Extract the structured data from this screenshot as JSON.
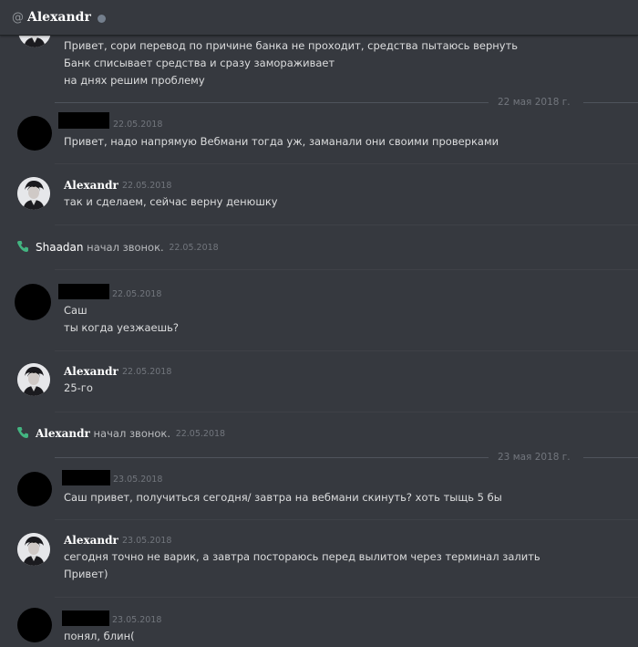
{
  "header": {
    "at_symbol": "@",
    "title": "Alexandr",
    "status": "offline"
  },
  "dividers": [
    "22 мая 2018 г.",
    "23 мая 2018 г."
  ],
  "messages": [
    {
      "lines": [
        "Привет, сори перевод по причине банка не проходит, средства пытаюсь вернуть",
        "Банк списывает средства и сразу замораживает",
        "на днях решим проблему"
      ]
    },
    {
      "time": "22.05.2018",
      "lines": [
        "Привет, надо напрямую Вебмани тогда уж, заманали они своими проверками"
      ]
    },
    {
      "author": "Alexandr",
      "time": "22.05.2018",
      "lines": [
        "так и сделаем, сейчас верну денюшку"
      ]
    },
    {
      "author": "Shaadan",
      "text": "начал звонок.",
      "time": "22.05.2018"
    },
    {
      "time": "22.05.2018",
      "lines": [
        "Саш",
        "ты когда уезжаешь?"
      ]
    },
    {
      "author": "Alexandr",
      "time": "22.05.2018",
      "lines": [
        "25-го"
      ]
    },
    {
      "author": "Alexandr",
      "text": "начал звонок.",
      "time": "22.05.2018"
    },
    {
      "time": "23.05.2018",
      "lines": [
        "Саш привет,  получиться сегодня/ завтра  на вебмани скинуть? хоть тыщь 5 бы"
      ]
    },
    {
      "author": "Alexandr",
      "time": "23.05.2018",
      "lines": [
        "сегодня точно не варик, а завтра постораюсь перед вылитом через терминал залить",
        "Привет)"
      ]
    },
    {
      "time": "23.05.2018",
      "lines": [
        "понял, блин("
      ]
    }
  ],
  "colors": {
    "background": "#36393f",
    "call_icon": "#43b581",
    "muted": "#72767d"
  }
}
